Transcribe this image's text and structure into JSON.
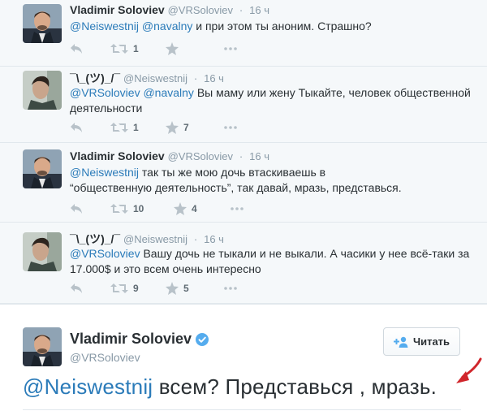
{
  "tweets": [
    {
      "name": "Vladimir Soloviev",
      "handle": "@VRSoloviev",
      "time": "16 ч",
      "mention1": "@Neiswestnij",
      "mention2": "@navalny",
      "text": " и при этом ты аноним. Страшно?",
      "retweets": "1",
      "favorites": "",
      "avatar": "man-in-suit"
    },
    {
      "name": "¯\\_(ツ)_/¯",
      "handle": "@Neiswestnij",
      "time": "16 ч",
      "mention1": "@VRSoloviev",
      "mention2": "@navalny",
      "text": " Вы маму или жену Тыкайте, человек общественной деятельности",
      "retweets": "1",
      "favorites": "7",
      "avatar": "young-man"
    },
    {
      "name": "Vladimir Soloviev",
      "handle": "@VRSoloviev",
      "time": "16 ч",
      "mention1": "@Neiswestnij",
      "text": " так ты же мою дочь втаскиваешь в “общественную деятельность”,  так давай, мразь, представься.",
      "retweets": "10",
      "favorites": "4",
      "avatar": "man-in-suit"
    },
    {
      "name": "¯\\_(ツ)_/¯",
      "handle": "@Neiswestnij",
      "time": "16 ч",
      "mention1": "@VRSoloviev",
      "text": " Вашу дочь не тыкали и не выкали. А часики у нее всё-таки за 17.000$ и это всем очень интересно",
      "retweets": "9",
      "favorites": "5",
      "avatar": "young-man"
    }
  ],
  "main": {
    "name": "Vladimir Soloviev",
    "handle": "@VRSoloviev",
    "follow_label": "Читать",
    "mention": "@Neiswestnij",
    "text": " всем? Представься , мразь."
  },
  "colors": {
    "link": "#2b7bb9",
    "verified": "#55acee",
    "annotation_arrow": "#d0252b"
  }
}
